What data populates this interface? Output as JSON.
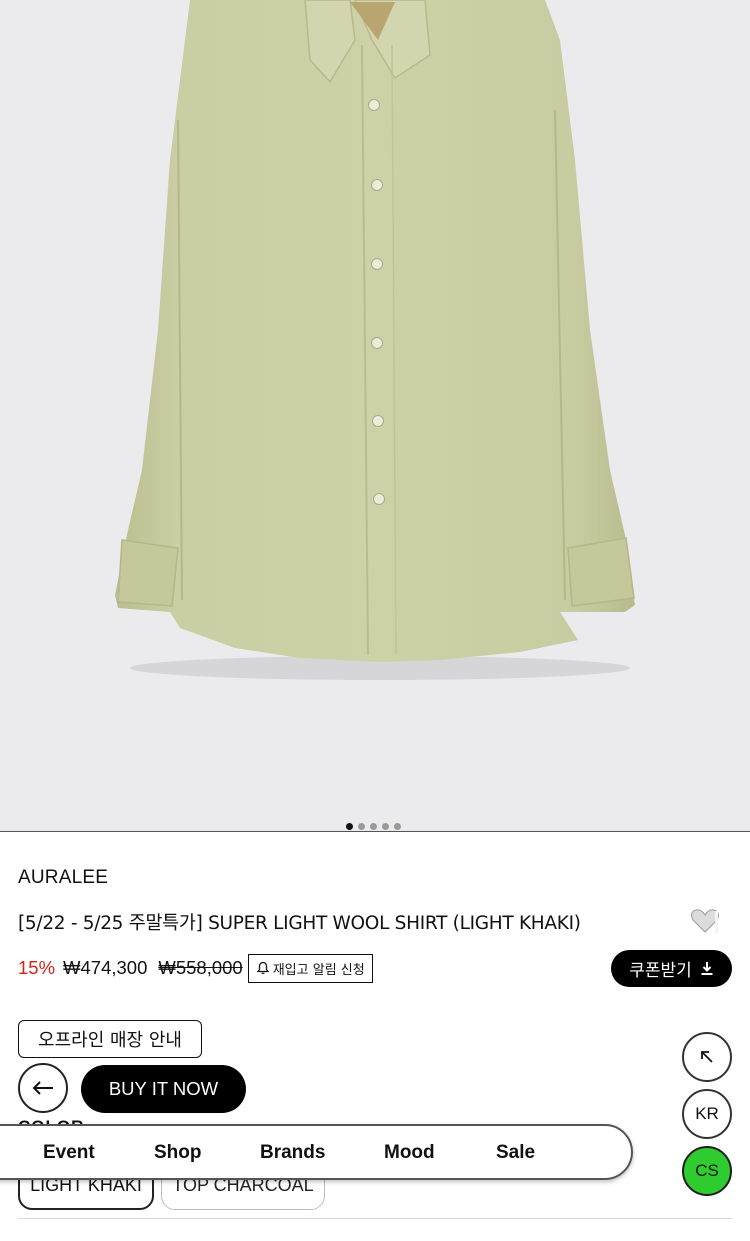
{
  "carousel": {
    "slide_count": 5,
    "active_index": 0
  },
  "product": {
    "brand": "AURALEE",
    "title": "[5/22 - 5/25 주말특가] SUPER LIGHT WOOL SHIRT (LIGHT KHAKI)",
    "discount": "15%",
    "price": "₩474,300",
    "original_price": "₩558,000",
    "restock_label": "재입고 알림 신청",
    "coupon_label": "쿠폰받기",
    "offline_label": "오프라인 매장 안내",
    "buy_label": "BUY IT NOW",
    "color_heading": "COLOR",
    "colors": [
      "LIGHT KHAKI",
      "TOP CHARCOAL"
    ]
  },
  "nav": {
    "items": [
      "Event",
      "Shop",
      "Brands",
      "Mood",
      "Sale"
    ]
  },
  "floating": {
    "top_icon": "arrow-up-left-icon",
    "lang_label": "KR",
    "cs_label": "CS",
    "cs_color": "#2ecc2e"
  },
  "colors": {
    "sale_red": "#d3241b",
    "shirt_khaki": "#c8cca0",
    "image_bg": "#ebebed"
  }
}
